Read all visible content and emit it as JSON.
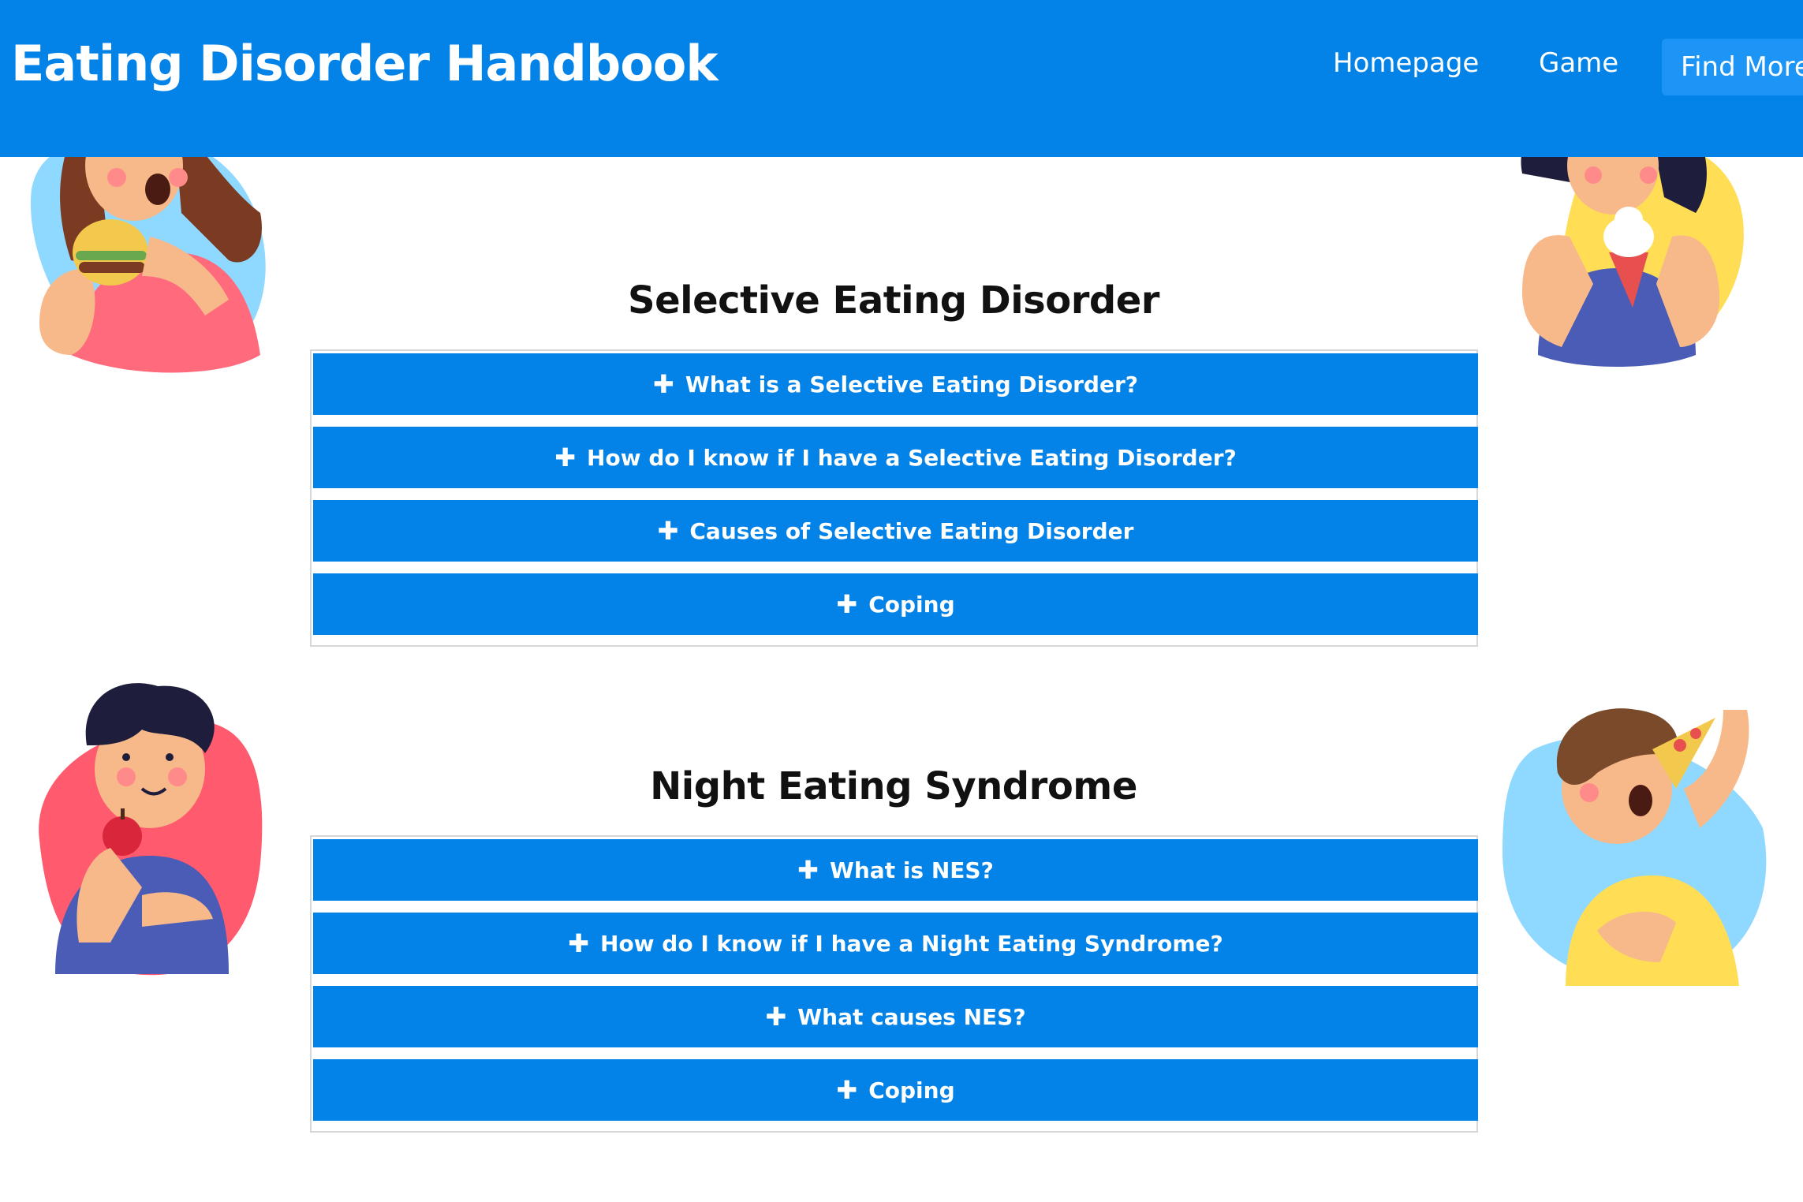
{
  "header": {
    "brand": "Eating Disorder Handbook",
    "nav": [
      "Homepage",
      "Game",
      "Find More"
    ]
  },
  "colors": {
    "primary": "#0382e8",
    "nav_active": "#1c95f6",
    "illustration_pink": "#ff6b7d",
    "illustration_yellow": "#ffdd55",
    "illustration_light_blue": "#8fd8ff",
    "illustration_red": "#ff5a6e"
  },
  "sections": [
    {
      "title": "Selective Eating Disorder",
      "items": [
        "What is a Selective Eating Disorder?",
        "How do I know if I have a Selective Eating Disorder?",
        "Causes of Selective Eating Disorder",
        "Coping"
      ]
    },
    {
      "title": "Night Eating Syndrome",
      "items": [
        "What is NES?",
        "How do I know if I have a Night Eating Syndrome?",
        "What causes NES?",
        "Coping"
      ]
    }
  ],
  "illustrations": [
    "girl-eating-burger",
    "girl-eating-ice-cream",
    "boy-eating-apple",
    "boy-eating-pizza"
  ],
  "icons": {
    "expand": "plus-icon"
  }
}
